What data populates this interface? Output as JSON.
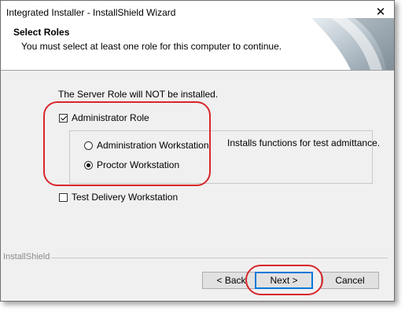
{
  "window": {
    "title": "Integrated Installer - InstallShield Wizard",
    "close_glyph": "✕"
  },
  "header": {
    "title": "Select Roles",
    "subtitle": "You must select at least one role for this computer to continue."
  },
  "body": {
    "notice": "The Server Role will NOT be installed.",
    "admin_role": {
      "label": "Administrator Role",
      "checked": true
    },
    "options": [
      {
        "label": "Administration Workstation",
        "selected": false
      },
      {
        "label": "Proctor Workstation",
        "selected": true
      }
    ],
    "description": "Installs functions for test admittance.",
    "test_delivery": {
      "label": "Test Delivery Workstation",
      "checked": false
    }
  },
  "footer": {
    "brand": "InstallShield",
    "back_label": "< Back",
    "next_label": "Next >",
    "cancel_label": "Cancel"
  },
  "colors": {
    "highlight": "#d9262b",
    "default_button_border": "#0078d7"
  }
}
